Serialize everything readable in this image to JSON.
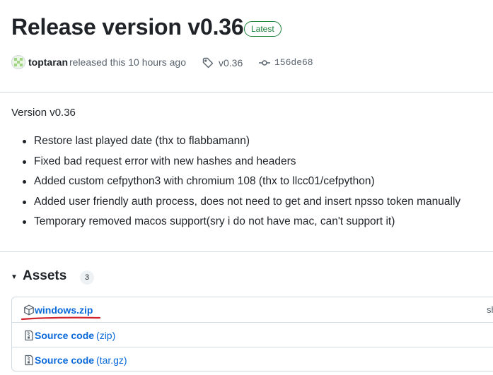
{
  "release": {
    "title": "Release version v0.36",
    "badge": "Latest",
    "author": "toptaran",
    "released_text": "released this 10 hours ago",
    "tag": "v0.36",
    "commit": "156de68"
  },
  "notes": {
    "heading": "Version v0.36",
    "items": [
      "Restore last played date (thx to flabbamann)",
      "Fixed bad request error with new hashes and headers",
      "Added custom cefpython3 with chromium 108 (thx to llcc01/cefpython)",
      "Added user friendly auth process, does not need to get and insert npsso token manually",
      "Temporary removed macos support(sry i do not have mac, can't support it)"
    ]
  },
  "assets": {
    "toggle_icon": "caret-down-icon",
    "title": "Assets",
    "count": "3",
    "items": [
      {
        "name": "windows.zip",
        "suffix": "",
        "icon": "package-icon",
        "right_text": "sh"
      },
      {
        "name": "Source code",
        "suffix": "(zip)",
        "icon": "file-zip-icon",
        "right_text": ""
      },
      {
        "name": "Source code",
        "suffix": "(tar.gz)",
        "icon": "file-zip-icon",
        "right_text": ""
      }
    ]
  },
  "colors": {
    "link": "#0969da",
    "latest_green": "#1a7f37",
    "annotation_red": "#d1242f"
  }
}
